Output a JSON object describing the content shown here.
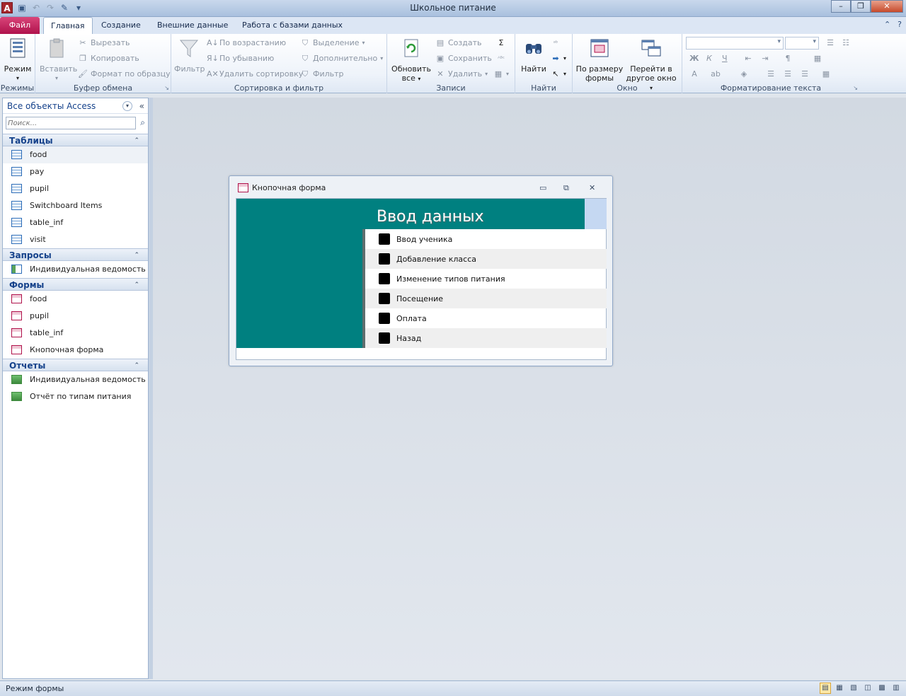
{
  "window": {
    "title": "Школьное питание"
  },
  "ribbon": {
    "file_tab": "Файл",
    "tabs": [
      "Главная",
      "Создание",
      "Внешние данные",
      "Работа с базами данных"
    ],
    "groups": {
      "views": {
        "label": "Режимы",
        "mode_button": "Режим"
      },
      "clipboard": {
        "label": "Буфер обмена",
        "paste": "Вставить",
        "cut": "Вырезать",
        "copy": "Копировать",
        "format_painter": "Формат по образцу"
      },
      "sort_filter": {
        "label": "Сортировка и фильтр",
        "filter": "Фильтр",
        "ascending": "По возрастанию",
        "descending": "По убыванию",
        "remove_sort": "Удалить сортировку",
        "selection": "Выделение",
        "advanced": "Дополнительно",
        "toggle_filter": "Фильтр"
      },
      "records": {
        "label": "Записи",
        "refresh_line1": "Обновить",
        "refresh_line2": "все",
        "new": "Создать",
        "save": "Сохранить",
        "delete": "Удалить"
      },
      "find": {
        "label": "Найти",
        "find": "Найти"
      },
      "window": {
        "label": "Окно",
        "fit_line1": "По размеру",
        "fit_line2": "формы",
        "switch_line1": "Перейти в",
        "switch_line2": "другое окно"
      },
      "text_format": {
        "label": "Форматирование текста",
        "bold": "Ж",
        "italic": "К",
        "underline": "Ч"
      }
    }
  },
  "nav": {
    "header": "Все объекты Access",
    "search_placeholder": "Поиск...",
    "sections": [
      {
        "title": "Таблицы",
        "items": [
          "food",
          "pay",
          "pupil",
          "Switchboard Items",
          "table_inf",
          "visit"
        ]
      },
      {
        "title": "Запросы",
        "items": [
          "Индивидуальная ведомость"
        ]
      },
      {
        "title": "Формы",
        "items": [
          "food",
          "pupil",
          "table_inf",
          "Кнопочная форма"
        ]
      },
      {
        "title": "Отчеты",
        "items": [
          "Индивидуальная ведомость",
          "Отчёт по типам питания"
        ]
      }
    ]
  },
  "form": {
    "title": "Кнопочная форма",
    "heading": "Ввод данных",
    "buttons": [
      "Ввод ученика",
      "Добавление класса",
      "Изменение типов питания",
      "Посещение",
      "Оплата",
      "Назад"
    ]
  },
  "status": {
    "text": "Режим формы"
  }
}
